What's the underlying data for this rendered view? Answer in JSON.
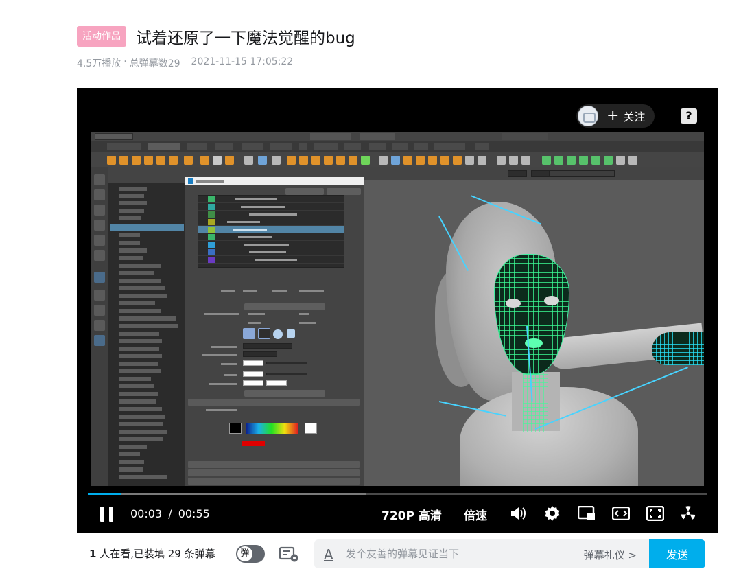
{
  "header": {
    "tag": "活动作品",
    "title": "试着还原了一下魔法觉醒的bug",
    "plays": "4.5万播放",
    "separator": "·",
    "danmaku_total": "总弹幕数29",
    "date": "2021-11-15 17:05:22"
  },
  "player": {
    "follow_label": "关注",
    "follow_plus": "+",
    "help_label": "?",
    "current_time": "00:03",
    "time_separator": "/",
    "duration": "00:55",
    "progress": 0.0545,
    "buffered": 0.45,
    "quality": "720P 高清",
    "speed": "倍速",
    "icons": [
      "pause-icon",
      "volume-icon",
      "settings-icon",
      "mini-window-icon",
      "widescreen-icon",
      "fullscreen-icon",
      "radiation-icon"
    ]
  },
  "colors": {
    "accent": "#00aeec",
    "tag_pink": "#f7a4c0",
    "mesh_green": "#3ff0a0"
  },
  "bottom": {
    "viewers_num": "1",
    "viewers_text": " 人在看,已装填 29 条弹幕",
    "danmu_toggle_label": "弹",
    "input_placeholder": "发个友善的弹幕见证当下",
    "etiquette": "弹幕礼仪 >",
    "send": "发送"
  }
}
